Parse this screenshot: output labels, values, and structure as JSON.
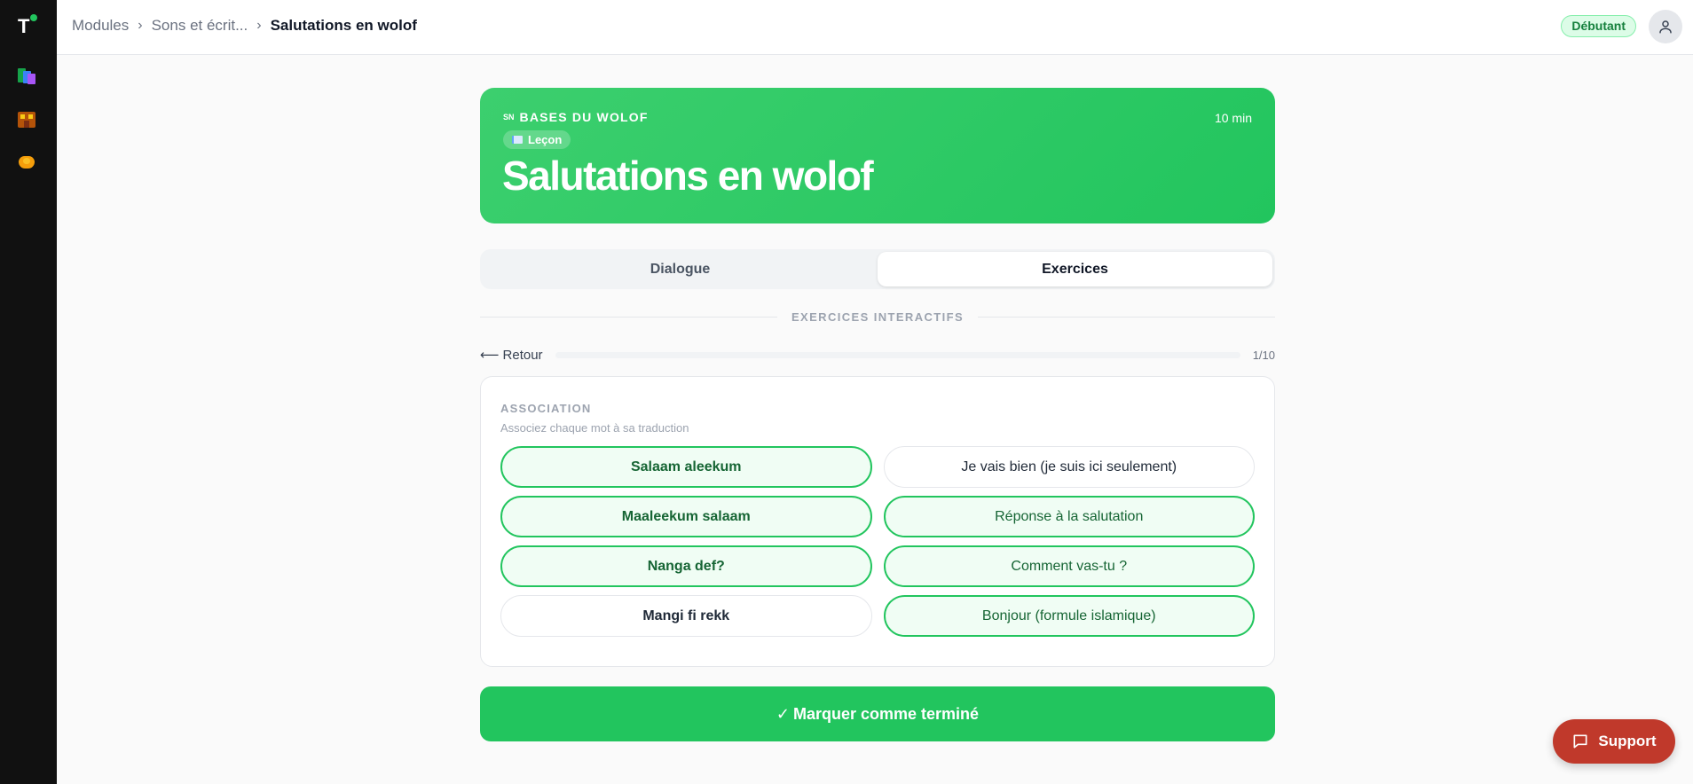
{
  "breadcrumb": {
    "items": [
      "Modules",
      "Sons et écrit..."
    ],
    "separator": "›",
    "current": "Salutations en wolof"
  },
  "header": {
    "level_badge": "Débutant",
    "user_icon": "user-icon"
  },
  "sidebar": {
    "logo": "T",
    "items": [
      {
        "icon": "books-icon"
      },
      {
        "icon": "school-icon"
      },
      {
        "icon": "heart-hands-icon"
      }
    ]
  },
  "lesson": {
    "flag": "SN",
    "module": "BASES DU WOLOF",
    "type": "Leçon",
    "type_icon": "book-icon",
    "title": "Salutations en wolof",
    "duration": "10 min"
  },
  "tabs": [
    {
      "label": "Dialogue",
      "active": false
    },
    {
      "label": "Exercices",
      "active": true
    }
  ],
  "section": {
    "title": "EXERCICES INTERACTIFS"
  },
  "progress": {
    "back_label": "Retour",
    "back_icon": "arrow-left-icon",
    "current": 1,
    "total": 10,
    "count_label": "1/10"
  },
  "exercise": {
    "type": "ASSOCIATION",
    "instruction": "Associez chaque mot à sa traduction",
    "left": [
      {
        "label": "Salaam aleekum",
        "matched": true
      },
      {
        "label": "Maaleekum salaam",
        "matched": true
      },
      {
        "label": "Nanga def?",
        "matched": true
      },
      {
        "label": "Mangi fi rekk",
        "matched": false
      }
    ],
    "right": [
      {
        "label": "Je vais bien (je suis ici seulement)",
        "matched": false
      },
      {
        "label": "Réponse à la salutation",
        "matched": true
      },
      {
        "label": "Comment vas-tu ?",
        "matched": true
      },
      {
        "label": "Bonjour (formule islamique)",
        "matched": true
      }
    ]
  },
  "complete_button": {
    "check": "✓",
    "label": "Marquer comme terminé"
  },
  "support_button": {
    "label": "Support",
    "icon": "chat-icon"
  },
  "colors": {
    "accent": "#22c55e",
    "sidebar": "#111111",
    "support": "#c0392b",
    "badge_bg": "#dcfce7",
    "badge_text": "#15803d"
  }
}
